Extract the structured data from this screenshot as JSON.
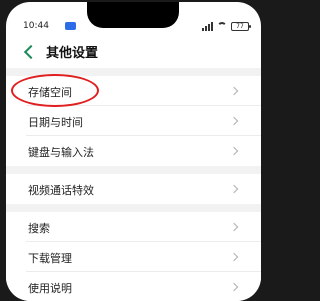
{
  "status_bar": {
    "time": "10:44",
    "battery": "77"
  },
  "header": {
    "title": "其他设置"
  },
  "settings": {
    "group1": [
      {
        "label": "存储空间"
      },
      {
        "label": "日期与时间"
      },
      {
        "label": "键盘与输入法"
      }
    ],
    "group2": [
      {
        "label": "视频通话特效"
      }
    ],
    "group3": [
      {
        "label": "搜索"
      },
      {
        "label": "下载管理"
      },
      {
        "label": "使用说明"
      }
    ]
  },
  "colors": {
    "accent": "#1a8a5a",
    "highlight": "#e02020",
    "background": "#ffffff",
    "separator": "#f2f2f2"
  },
  "icons": {
    "back": "chevron-left-icon",
    "row": "chevron-right-icon"
  }
}
